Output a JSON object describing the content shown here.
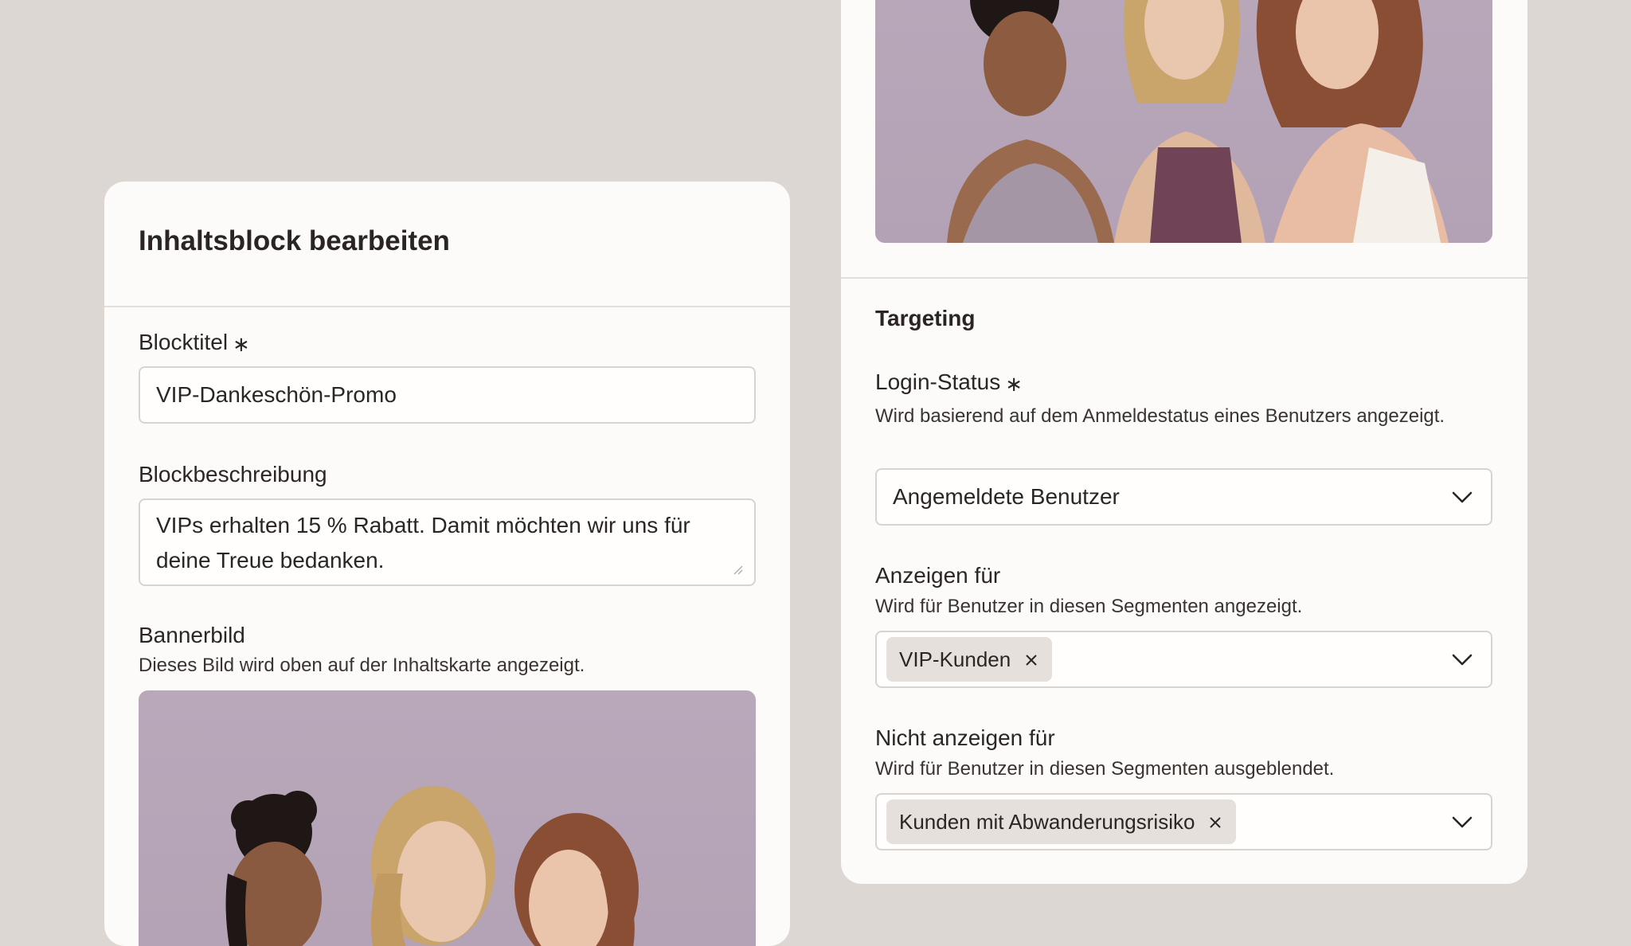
{
  "edit_card": {
    "title": "Inhaltsblock bearbeiten",
    "block_title": {
      "label": "Blocktitel",
      "required_mark": "∗",
      "value": "VIP-Dankeschön-Promo"
    },
    "block_description": {
      "label": "Blockbeschreibung",
      "value": "VIPs erhalten 15 % Rabatt. Damit möchten wir uns für deine Treue bedanken."
    },
    "banner_image": {
      "label": "Bannerbild",
      "help": "Dieses Bild wird oben auf der Inhaltskarte angezeigt."
    }
  },
  "targeting_card": {
    "heading": "Targeting",
    "login_status": {
      "label": "Login-Status",
      "required_mark": "∗",
      "help": "Wird basierend auf dem Anmeldestatus eines Benutzers angezeigt.",
      "value": "Angemeldete Benutzer"
    },
    "show_for": {
      "label": "Anzeigen für",
      "help": "Wird für Benutzer in diesen Segmenten angezeigt.",
      "tags": [
        "VIP-Kunden"
      ]
    },
    "hide_for": {
      "label": "Nicht anzeigen für",
      "help": "Wird für Benutzer in diesen Segmenten ausgeblendet.",
      "tags": [
        "Kunden mit Abwanderungsrisiko"
      ]
    }
  },
  "icons": {
    "dropdown": "chevron-down-icon",
    "remove_tag": "close-icon",
    "required": "asterisk",
    "textarea_resize": "resize-handle-icon"
  },
  "colors": {
    "page_background": "#dcd7d3",
    "card_background": "#fdfbf9",
    "photo_background": "#b8a8ba",
    "tag_background": "#e6e0dc",
    "text": "#2b2623"
  }
}
